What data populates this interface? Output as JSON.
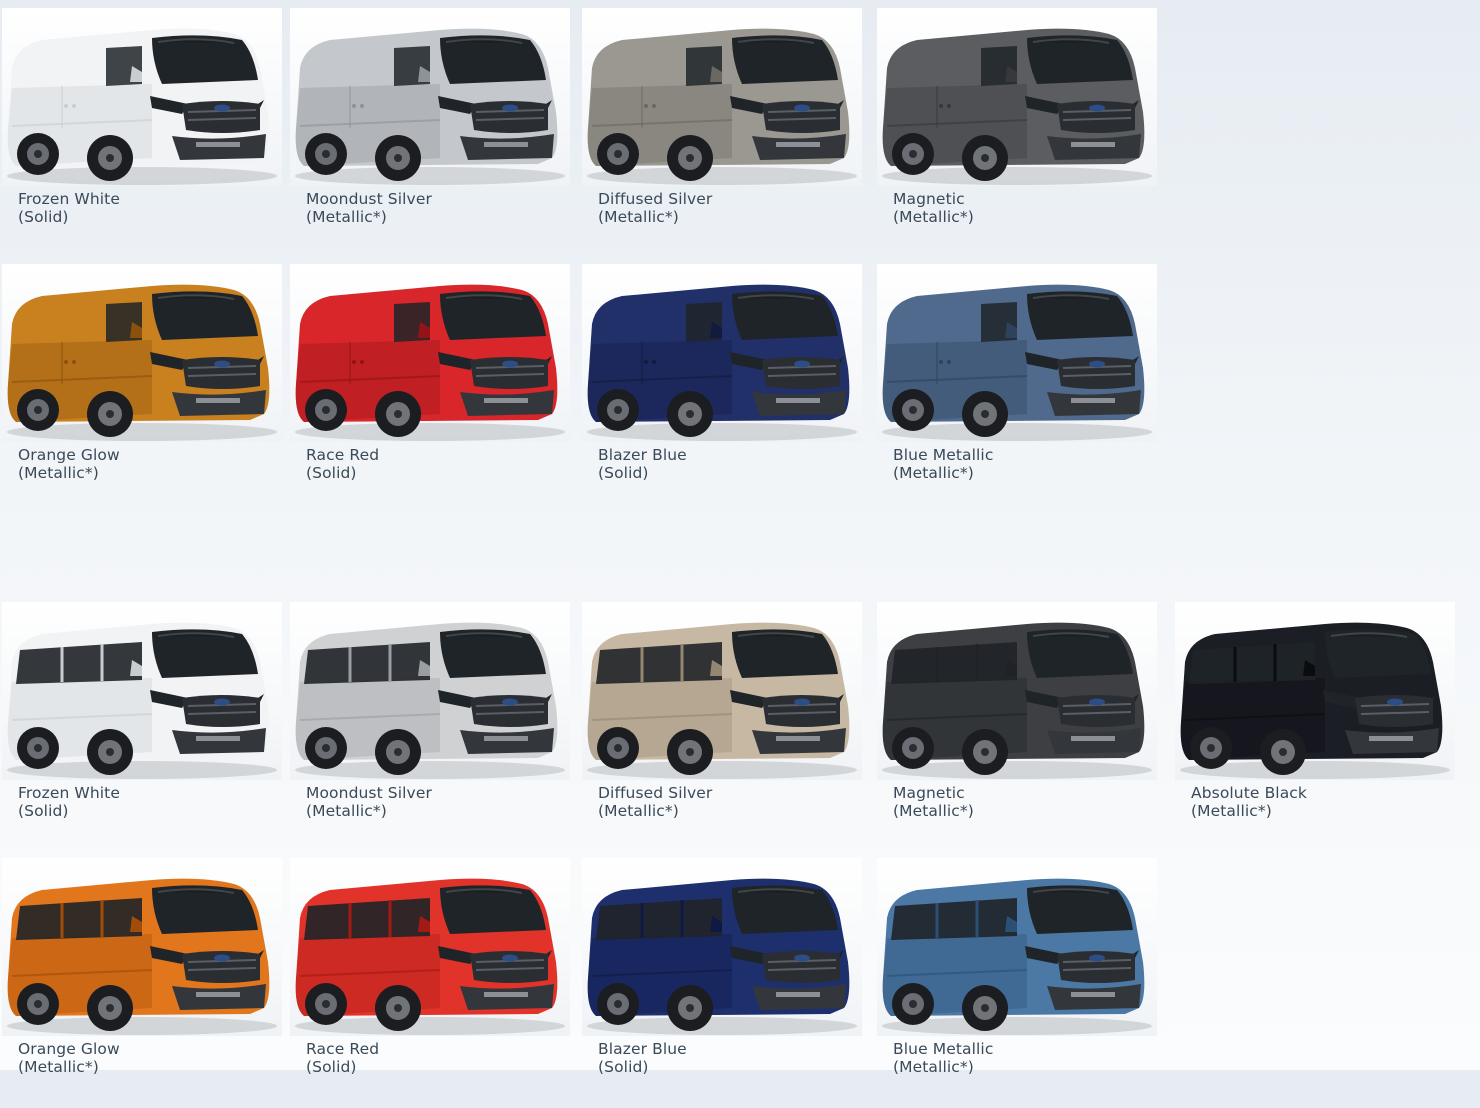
{
  "sections": [
    {
      "id": "cargo",
      "swatches": [
        {
          "name": "Frozen White",
          "finish": "(Solid)",
          "color": "#f2f3f5",
          "shade": "#c9cdd2"
        },
        {
          "name": "Moondust Silver",
          "finish": "(Metallic*)",
          "color": "#c4c7cb",
          "shade": "#8e9399"
        },
        {
          "name": "Diffused Silver",
          "finish": "(Metallic*)",
          "color": "#9b9891",
          "shade": "#6b6862"
        },
        {
          "name": "Magnetic",
          "finish": "(Metallic*)",
          "color": "#5b5d60",
          "shade": "#36383b"
        },
        {
          "name": "Orange Glow",
          "finish": "(Metallic*)",
          "color": "#c9801f",
          "shade": "#8a520d"
        },
        {
          "name": "Race Red",
          "finish": "(Solid)",
          "color": "#d9262a",
          "shade": "#931416"
        },
        {
          "name": "Blazer Blue",
          "finish": "(Solid)",
          "color": "#22306a",
          "shade": "#121a3f"
        },
        {
          "name": "Blue Metallic",
          "finish": "(Metallic*)",
          "color": "#4f6a8c",
          "shade": "#2e425c"
        }
      ]
    },
    {
      "id": "passenger",
      "swatches": [
        {
          "name": "Frozen White",
          "finish": "(Solid)",
          "color": "#f2f3f5",
          "shade": "#c9cdd2"
        },
        {
          "name": "Moondust Silver",
          "finish": "(Metallic*)",
          "color": "#cfd1d3",
          "shade": "#9a9ea3"
        },
        {
          "name": "Diffused Silver",
          "finish": "(Metallic*)",
          "color": "#c7b8a3",
          "shade": "#958672"
        },
        {
          "name": "Magnetic",
          "finish": "(Metallic*)",
          "color": "#3d3f43",
          "shade": "#202225"
        },
        {
          "name": "Absolute Black",
          "finish": "(Metallic*)",
          "color": "#1c1e26",
          "shade": "#0b0c10"
        },
        {
          "name": "Orange Glow",
          "finish": "(Metallic*)",
          "color": "#e2761c",
          "shade": "#a14c08"
        },
        {
          "name": "Race Red",
          "finish": "(Solid)",
          "color": "#e2332b",
          "shade": "#a31914"
        },
        {
          "name": "Blazer Blue",
          "finish": "(Solid)",
          "color": "#1e2f6e",
          "shade": "#0f1a44"
        },
        {
          "name": "Blue Metallic",
          "finish": "(Metallic*)",
          "color": "#4c78a6",
          "shade": "#2c4f74"
        }
      ]
    }
  ]
}
